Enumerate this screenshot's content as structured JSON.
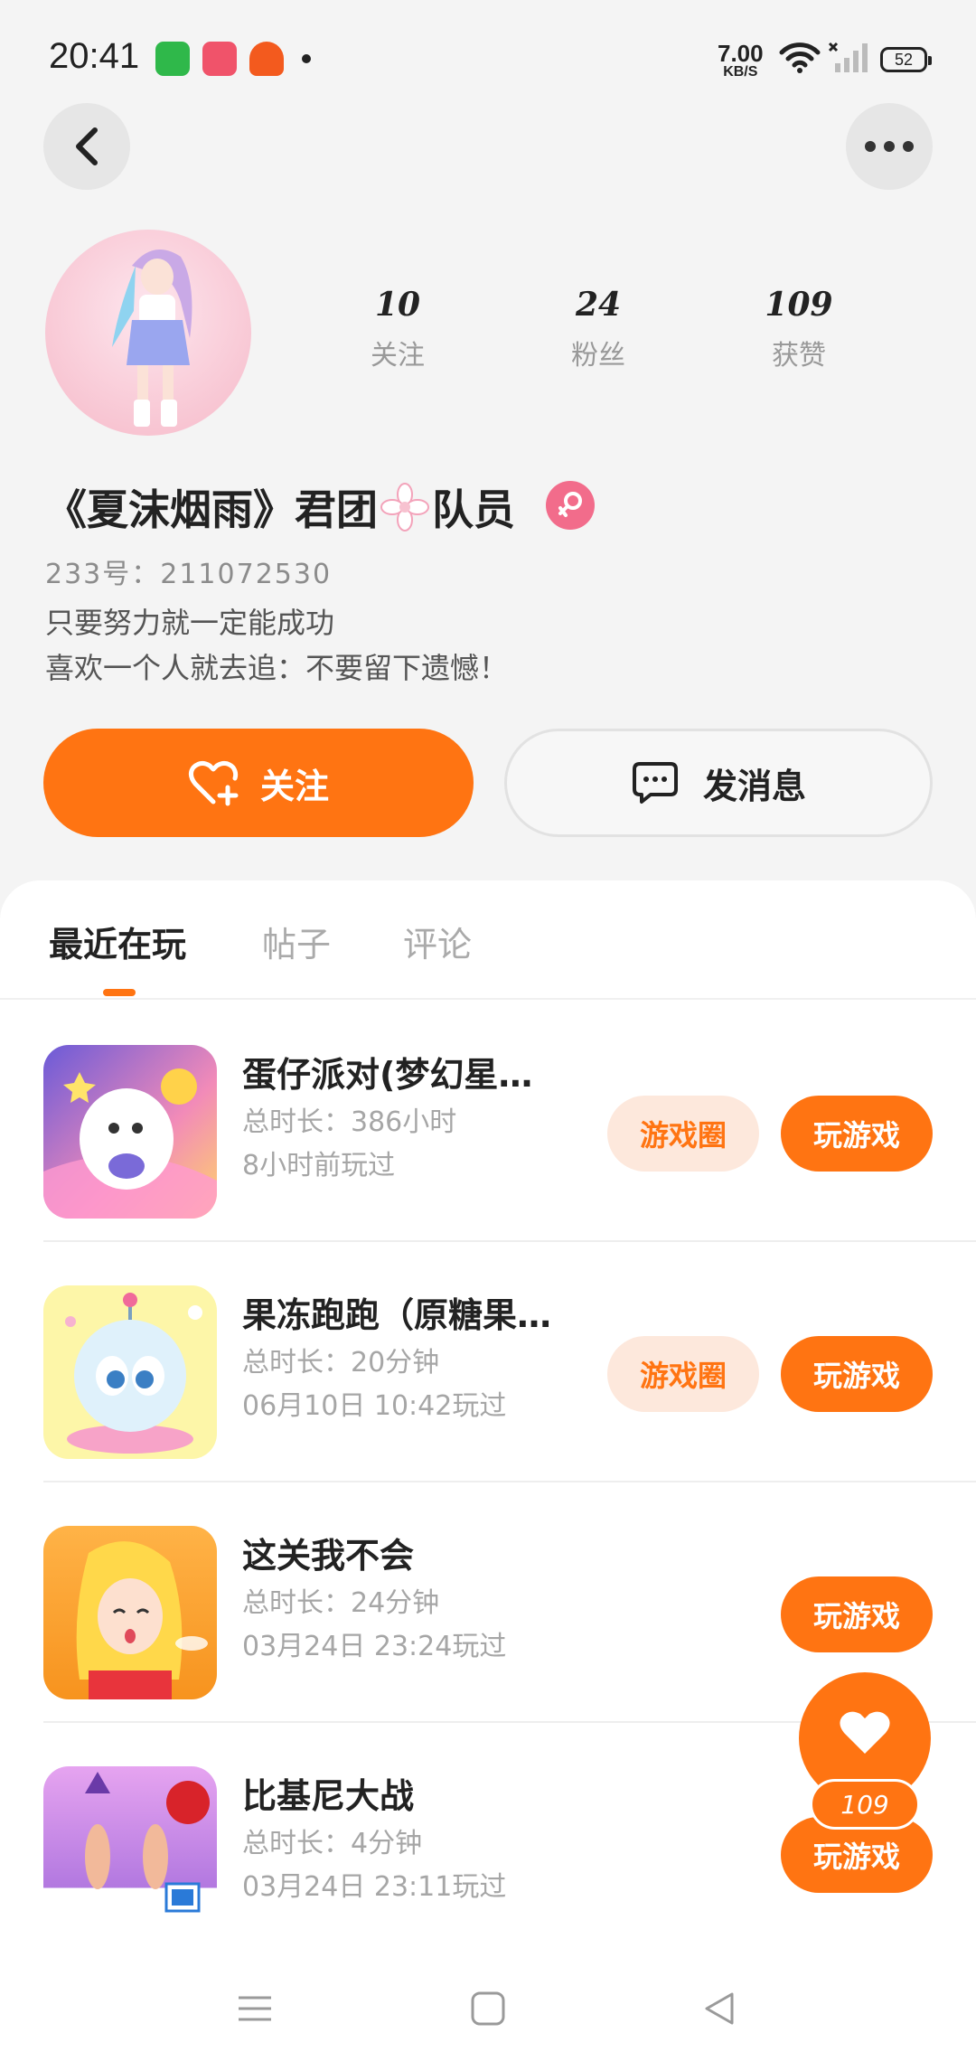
{
  "status_bar": {
    "time": "20:41",
    "net_speed_value": "7.00",
    "net_speed_unit": "KB/S",
    "battery": "52"
  },
  "profile": {
    "stats": [
      {
        "value": "10",
        "label": "关注"
      },
      {
        "value": "24",
        "label": "粉丝"
      },
      {
        "value": "109",
        "label": "获赞"
      }
    ],
    "nickname_part1": "《夏沫烟雨》君团",
    "nickname_part2": "队员",
    "uid": "233号：211072530",
    "bio_line1": "只要努力就一定能成功",
    "bio_line2": "喜欢一个人就去追：不要留下遗憾！",
    "follow_label": "关注",
    "message_label": "发消息"
  },
  "tabs": [
    {
      "label": "最近在玩",
      "active": true
    },
    {
      "label": "帖子",
      "active": false
    },
    {
      "label": "评论",
      "active": false
    }
  ],
  "games": [
    {
      "name": "蛋仔派对(梦幻星…",
      "duration": "总时长：386小时",
      "last_played": "8小时前玩过",
      "circle_label": "游戏圈",
      "play_label": "玩游戏"
    },
    {
      "name": "果冻跑跑（原糖果…",
      "duration": "总时长：20分钟",
      "last_played": "06月10日 10:42玩过",
      "circle_label": "游戏圈",
      "play_label": "玩游戏"
    },
    {
      "name": "这关我不会",
      "duration": "总时长：24分钟",
      "last_played": "03月24日 23:24玩过",
      "play_label": "玩游戏"
    },
    {
      "name": "比基尼大战",
      "duration": "总时长：4分钟",
      "last_played": "03月24日 23:11玩过",
      "play_label": "玩游戏"
    }
  ],
  "like_fab": {
    "count": "109"
  },
  "colors": {
    "accent": "#ff7412",
    "accent_light": "#fde8dc",
    "gender": "#f26c8b"
  },
  "icons": [
    "back-icon",
    "more-icon",
    "heart-plus-icon",
    "chat-icon",
    "female-icon",
    "heart-icon",
    "menu-icon",
    "home-icon",
    "back-nav-icon"
  ]
}
